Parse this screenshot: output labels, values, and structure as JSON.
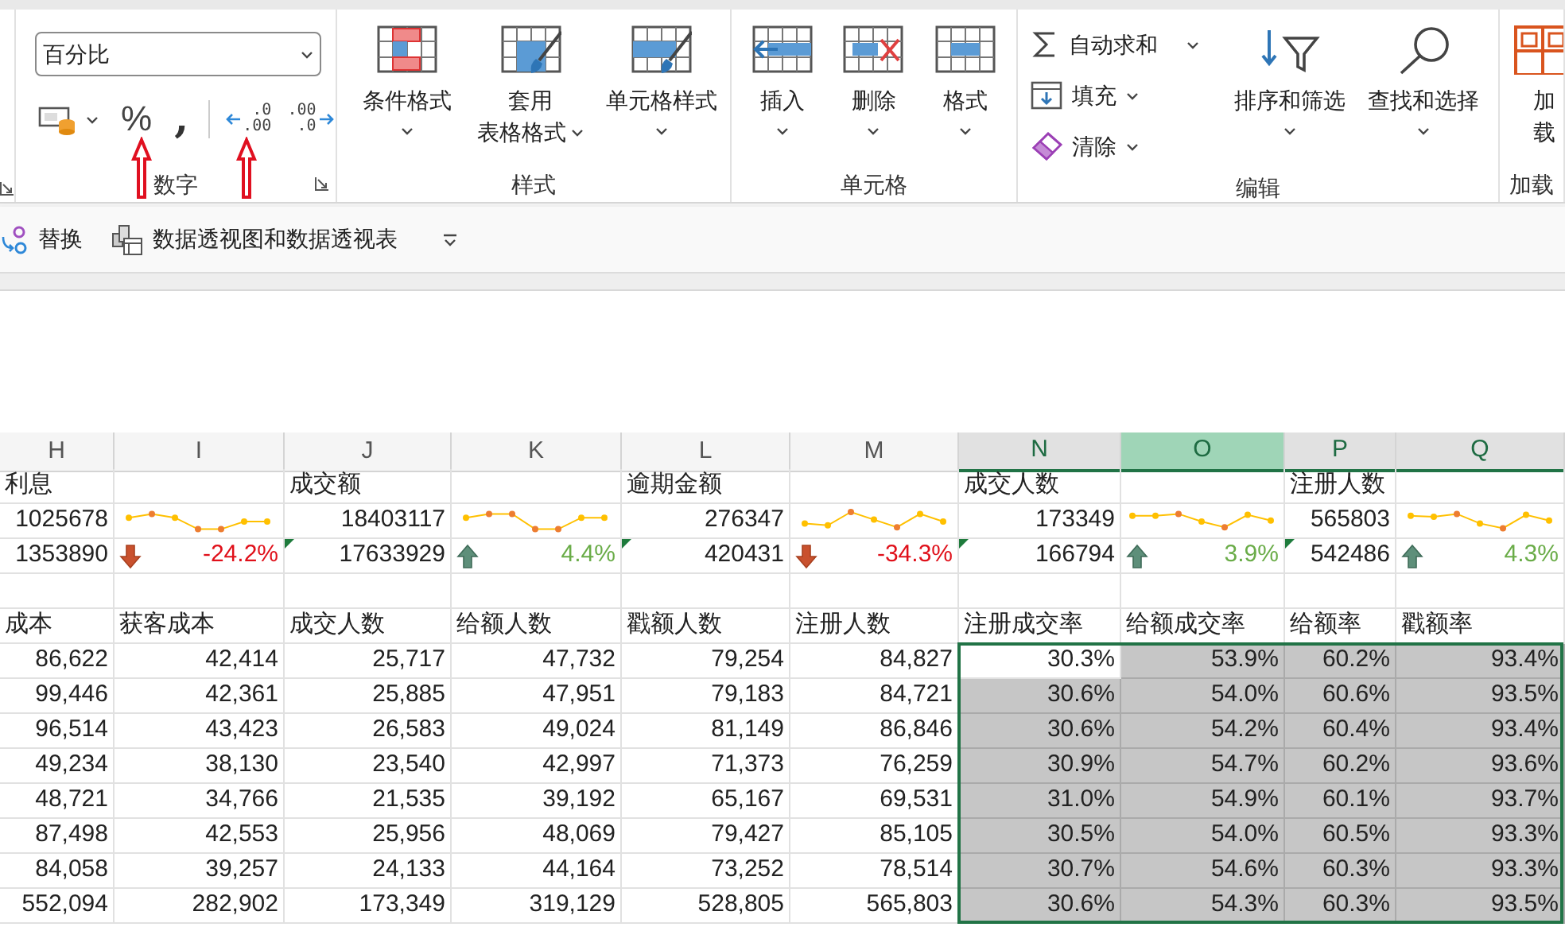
{
  "ribbon": {
    "groups": [
      {
        "label": "数字",
        "items": [
          {
            "kind": "format_dropdown",
            "value": "百分比"
          },
          {
            "kind": "icon_row",
            "buttons": [
              {
                "kind": "accounting"
              },
              {
                "kind": "percent",
                "text": "%"
              },
              {
                "kind": "comma",
                "text": ","
              },
              {
                "kind": "increase_decimal",
                "lines": [
                  ".0",
                  ".00"
                ]
              },
              {
                "kind": "decrease_decimal",
                "lines": [
                  ".00",
                  ".0"
                ]
              }
            ]
          }
        ]
      },
      {
        "label": "样式",
        "items": [
          {
            "kind": "large_button",
            "lines": [
              "条件格式"
            ]
          },
          {
            "kind": "large_button",
            "lines": [
              "套用",
              "表格格式"
            ]
          },
          {
            "kind": "large_button",
            "lines": [
              "单元格样式"
            ]
          }
        ]
      },
      {
        "label": "单元格",
        "items": [
          {
            "kind": "large_button",
            "lines": [
              "插入"
            ]
          },
          {
            "kind": "large_button",
            "lines": [
              "删除"
            ]
          },
          {
            "kind": "large_button",
            "lines": [
              "格式"
            ]
          }
        ]
      },
      {
        "label": "编辑",
        "items": [
          {
            "kind": "button_stack",
            "buttons": [
              {
                "label": "自动求和"
              },
              {
                "label": "填充"
              },
              {
                "label": "清除"
              }
            ]
          },
          {
            "kind": "large_button",
            "lines": [
              "排序和筛选"
            ]
          },
          {
            "kind": "large_button",
            "lines": [
              "查找和选择"
            ]
          }
        ]
      },
      {
        "label": "加载",
        "items": [
          {
            "kind": "large_button",
            "lines": [
              "加",
              "载"
            ]
          }
        ]
      }
    ]
  },
  "quick_bar": {
    "items": [
      {
        "kind": "replace",
        "label": "替换"
      },
      {
        "kind": "pivot",
        "label": "数据透视图和数据透视表"
      }
    ]
  },
  "sheet": {
    "columns": [
      {
        "letter": "H",
        "selected": false,
        "highlighted": false
      },
      {
        "letter": "I",
        "selected": false,
        "highlighted": false
      },
      {
        "letter": "J",
        "selected": false,
        "highlighted": false
      },
      {
        "letter": "K",
        "selected": false,
        "highlighted": false
      },
      {
        "letter": "L",
        "selected": false,
        "highlighted": false
      },
      {
        "letter": "M",
        "selected": false,
        "highlighted": false
      },
      {
        "letter": "N",
        "selected": false,
        "highlighted": true
      },
      {
        "letter": "O",
        "selected": true,
        "highlighted": true
      },
      {
        "letter": "P",
        "selected": false,
        "highlighted": true
      },
      {
        "letter": "Q",
        "selected": false,
        "highlighted": true
      }
    ],
    "rows": [
      {
        "kind": "summary",
        "cells": [
          {
            "kind": "text",
            "text": "利息"
          },
          {
            "kind": "empty"
          },
          {
            "kind": "text",
            "text": "成交额"
          },
          {
            "kind": "empty"
          },
          {
            "kind": "text",
            "text": "逾期金额"
          },
          {
            "kind": "empty"
          },
          {
            "kind": "text",
            "text": "成交人数"
          },
          {
            "kind": "empty"
          },
          {
            "kind": "text",
            "text": "注册人数"
          },
          {
            "kind": "empty"
          }
        ]
      },
      {
        "kind": "summary",
        "cells": [
          {
            "kind": "number",
            "text": "1025678"
          },
          {
            "kind": "sparkline"
          },
          {
            "kind": "number",
            "text": "18403117"
          },
          {
            "kind": "sparkline"
          },
          {
            "kind": "number",
            "text": "276347"
          },
          {
            "kind": "sparkline"
          },
          {
            "kind": "number",
            "text": "173349"
          },
          {
            "kind": "sparkline"
          },
          {
            "kind": "number",
            "text": "565803"
          },
          {
            "kind": "sparkline"
          }
        ]
      },
      {
        "kind": "summary",
        "cells": [
          {
            "kind": "number",
            "text": "1353890",
            "flag": false
          },
          {
            "kind": "trend",
            "rising": false,
            "text": "-24.2%"
          },
          {
            "kind": "number",
            "text": "17633929",
            "flag": true
          },
          {
            "kind": "trend",
            "rising": true,
            "text": "4.4%"
          },
          {
            "kind": "number",
            "text": "420431",
            "flag": true
          },
          {
            "kind": "trend",
            "rising": false,
            "text": "-34.3%"
          },
          {
            "kind": "number",
            "text": "166794",
            "flag": true
          },
          {
            "kind": "trend",
            "rising": true,
            "text": "3.9%"
          },
          {
            "kind": "number",
            "text": "542486",
            "flag": true
          },
          {
            "kind": "trend",
            "rising": true,
            "text": "4.3%"
          }
        ]
      },
      {
        "kind": "summary",
        "cells": [
          {
            "kind": "empty"
          },
          {
            "kind": "empty"
          },
          {
            "kind": "empty"
          },
          {
            "kind": "empty"
          },
          {
            "kind": "empty"
          },
          {
            "kind": "empty"
          },
          {
            "kind": "empty"
          },
          {
            "kind": "empty"
          },
          {
            "kind": "empty"
          },
          {
            "kind": "empty"
          }
        ]
      },
      {
        "kind": "summary",
        "cells": [
          {
            "kind": "text",
            "text": "成本"
          },
          {
            "kind": "text",
            "text": "获客成本"
          },
          {
            "kind": "text",
            "text": "成交人数"
          },
          {
            "kind": "text",
            "text": "给额人数"
          },
          {
            "kind": "text",
            "text": "戳额人数"
          },
          {
            "kind": "text",
            "text": "注册人数"
          },
          {
            "kind": "text",
            "text": "注册成交率"
          },
          {
            "kind": "text",
            "text": "给额成交率"
          },
          {
            "kind": "text",
            "text": "给额率"
          },
          {
            "kind": "text",
            "text": "戳额率"
          }
        ]
      },
      {
        "kind": "data",
        "cells": [
          {
            "text": "86,622",
            "selected": false
          },
          {
            "text": "42,414",
            "selected": false
          },
          {
            "text": "25,717",
            "selected": false
          },
          {
            "text": "47,732",
            "selected": false
          },
          {
            "text": "79,254",
            "selected": false
          },
          {
            "text": "84,827",
            "selected": false
          },
          {
            "text": "30.3%",
            "selected": false
          },
          {
            "text": "53.9%",
            "selected": true
          },
          {
            "text": "60.2%",
            "selected": true
          },
          {
            "text": "93.4%",
            "selected": true
          }
        ]
      },
      {
        "kind": "data",
        "cells": [
          {
            "text": "99,446",
            "selected": false
          },
          {
            "text": "42,361",
            "selected": false
          },
          {
            "text": "25,885",
            "selected": false
          },
          {
            "text": "47,951",
            "selected": false
          },
          {
            "text": "79,183",
            "selected": false
          },
          {
            "text": "84,721",
            "selected": false
          },
          {
            "text": "30.6%",
            "selected": true
          },
          {
            "text": "54.0%",
            "selected": true
          },
          {
            "text": "60.6%",
            "selected": true
          },
          {
            "text": "93.5%",
            "selected": true
          }
        ]
      },
      {
        "kind": "data",
        "cells": [
          {
            "text": "96,514",
            "selected": false
          },
          {
            "text": "43,423",
            "selected": false
          },
          {
            "text": "26,583",
            "selected": false
          },
          {
            "text": "49,024",
            "selected": false
          },
          {
            "text": "81,149",
            "selected": false
          },
          {
            "text": "86,846",
            "selected": false
          },
          {
            "text": "30.6%",
            "selected": true
          },
          {
            "text": "54.2%",
            "selected": true
          },
          {
            "text": "60.4%",
            "selected": true
          },
          {
            "text": "93.4%",
            "selected": true
          }
        ]
      },
      {
        "kind": "data",
        "cells": [
          {
            "text": "49,234",
            "selected": false
          },
          {
            "text": "38,130",
            "selected": false
          },
          {
            "text": "23,540",
            "selected": false
          },
          {
            "text": "42,997",
            "selected": false
          },
          {
            "text": "71,373",
            "selected": false
          },
          {
            "text": "76,259",
            "selected": false
          },
          {
            "text": "30.9%",
            "selected": true
          },
          {
            "text": "54.7%",
            "selected": true
          },
          {
            "text": "60.2%",
            "selected": true
          },
          {
            "text": "93.6%",
            "selected": true
          }
        ]
      },
      {
        "kind": "data",
        "cells": [
          {
            "text": "48,721",
            "selected": false
          },
          {
            "text": "34,766",
            "selected": false
          },
          {
            "text": "21,535",
            "selected": false
          },
          {
            "text": "39,192",
            "selected": false
          },
          {
            "text": "65,167",
            "selected": false
          },
          {
            "text": "69,531",
            "selected": false
          },
          {
            "text": "31.0%",
            "selected": true
          },
          {
            "text": "54.9%",
            "selected": true
          },
          {
            "text": "60.1%",
            "selected": true
          },
          {
            "text": "93.7%",
            "selected": true
          }
        ]
      },
      {
        "kind": "data",
        "cells": [
          {
            "text": "87,498",
            "selected": false
          },
          {
            "text": "42,553",
            "selected": false
          },
          {
            "text": "25,956",
            "selected": false
          },
          {
            "text": "48,069",
            "selected": false
          },
          {
            "text": "79,427",
            "selected": false
          },
          {
            "text": "85,105",
            "selected": false
          },
          {
            "text": "30.5%",
            "selected": true
          },
          {
            "text": "54.0%",
            "selected": true
          },
          {
            "text": "60.5%",
            "selected": true
          },
          {
            "text": "93.3%",
            "selected": true
          }
        ]
      },
      {
        "kind": "data",
        "cells": [
          {
            "text": "84,058",
            "selected": false
          },
          {
            "text": "39,257",
            "selected": false
          },
          {
            "text": "24,133",
            "selected": false
          },
          {
            "text": "44,164",
            "selected": false
          },
          {
            "text": "73,252",
            "selected": false
          },
          {
            "text": "78,514",
            "selected": false
          },
          {
            "text": "30.7%",
            "selected": true
          },
          {
            "text": "54.6%",
            "selected": true
          },
          {
            "text": "60.3%",
            "selected": true
          },
          {
            "text": "93.3%",
            "selected": true
          }
        ]
      },
      {
        "kind": "data",
        "cells": [
          {
            "text": "552,094",
            "selected": false
          },
          {
            "text": "282,902",
            "selected": false
          },
          {
            "text": "173,349",
            "selected": false
          },
          {
            "text": "319,129",
            "selected": false
          },
          {
            "text": "528,805",
            "selected": false
          },
          {
            "text": "565,803",
            "selected": false
          },
          {
            "text": "30.6%",
            "selected": true
          },
          {
            "text": "54.3%",
            "selected": true
          },
          {
            "text": "60.3%",
            "selected": true
          },
          {
            "text": "93.5%",
            "selected": true
          }
        ]
      }
    ]
  }
}
